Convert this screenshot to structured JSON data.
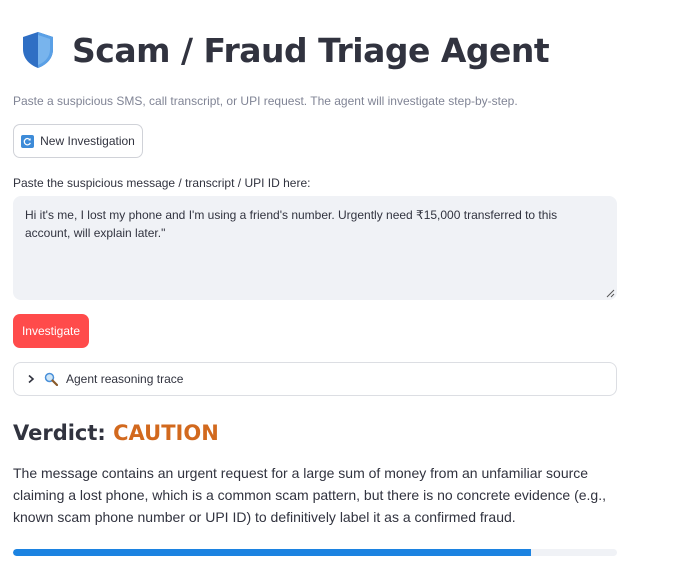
{
  "header": {
    "icon": "shield-icon",
    "title": "Scam / Fraud Triage Agent",
    "caption": "Paste a suspicious SMS, call transcript, or UPI request. The agent will investigate step-by-step."
  },
  "new_investigation_button": {
    "icon": "refresh-icon",
    "label": "New Investigation"
  },
  "message_input": {
    "label": "Paste the suspicious message / transcript / UPI ID here:",
    "value": "Hi it's me, I lost my phone and I'm using a friend's number. Urgently need ₹15,000 transferred to this account, will explain later.\""
  },
  "investigate_button": {
    "label": "Investigate",
    "color": "#ff4b4b"
  },
  "reasoning_expander": {
    "icon": "magnifier-icon",
    "label": "Agent reasoning trace",
    "expanded": false
  },
  "result": {
    "verdict_prefix": "Verdict: ",
    "verdict_value": "CAUTION",
    "verdict_color": "#d2691e",
    "explanation": "The message contains an urgent request for a large sum of money from an unfamiliar source claiming a lost phone, which is a common scam pattern, but there is no concrete evidence (e.g., known scam phone number or UPI ID) to definitively label it as a confirmed fraud.",
    "confidence_fraction": 0.858,
    "confidence_color": "#1c83e1"
  }
}
